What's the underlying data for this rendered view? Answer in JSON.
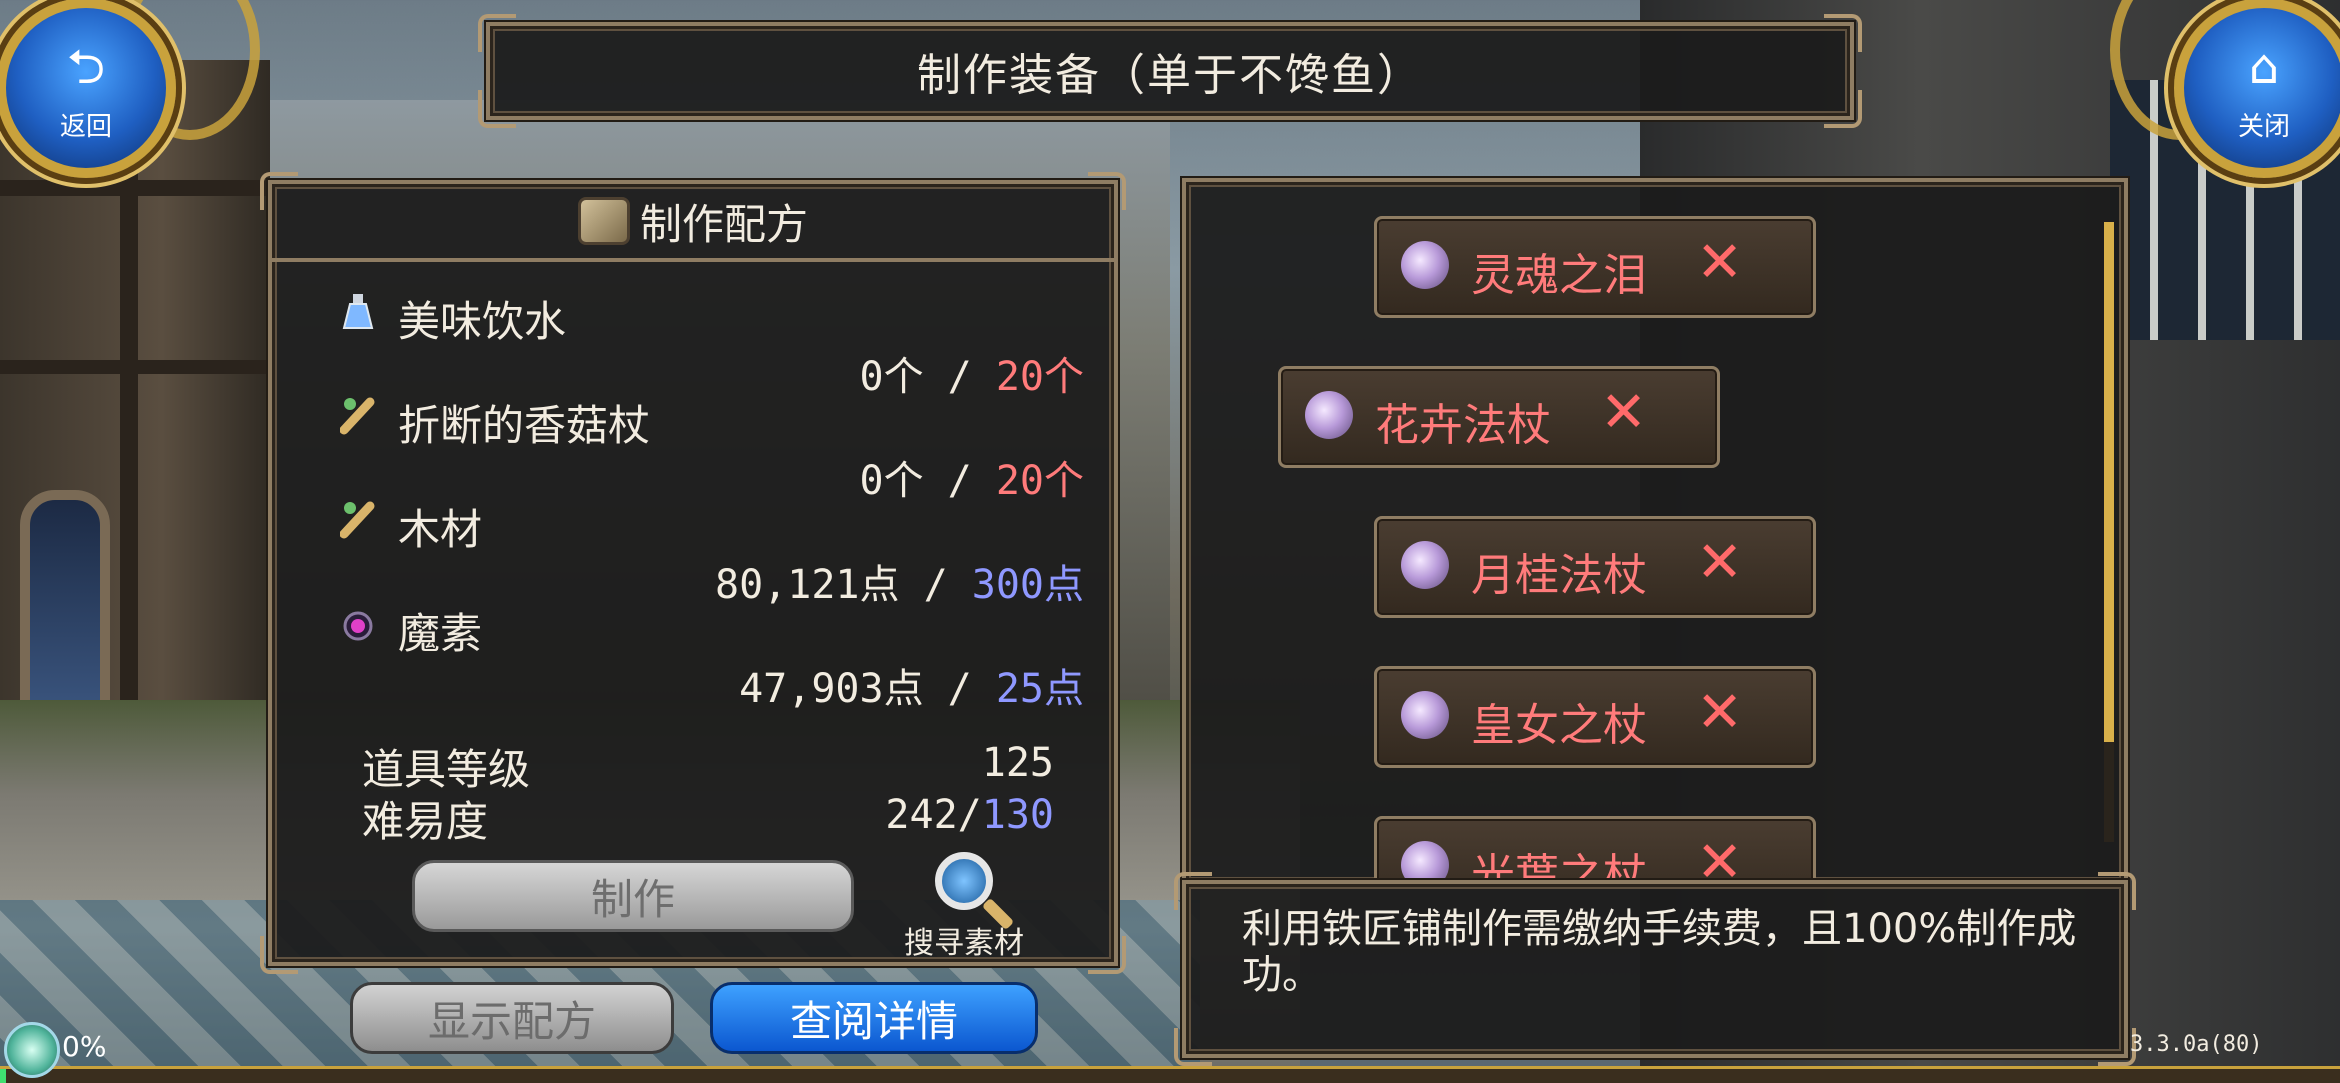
{
  "title": "制作装备（单于不馋鱼）",
  "nav": {
    "back_label": "返回",
    "close_label": "关闭",
    "back_icon": "return-arrow-icon",
    "close_icon": "home-icon"
  },
  "recipe": {
    "header": "制作配方",
    "materials": [
      {
        "name": "美味饮水",
        "have": "0个",
        "sep": " / ",
        "need": "20个",
        "need_color": "#ff7b7b",
        "icon": "potion-icon"
      },
      {
        "name": "折断的香菇杖",
        "have": "0个",
        "sep": " / ",
        "need": "20个",
        "need_color": "#ff7b7b",
        "icon": "wood-scroll-icon"
      },
      {
        "name": "木材",
        "have": "80,121点",
        "sep": " / ",
        "need": "300点",
        "need_color": "#8f98ff",
        "icon": "wood-scroll-icon"
      },
      {
        "name": "魔素",
        "have": "47,903点",
        "sep": " / ",
        "need": "25点",
        "need_color": "#8f98ff",
        "icon": "mana-orb-icon"
      }
    ],
    "item_level_label": "道具等级",
    "item_level_value": "125",
    "difficulty_label": "难易度",
    "difficulty_current": "242",
    "difficulty_sep": "/",
    "difficulty_max": "130",
    "craft_label": "制作",
    "search_label": "搜寻素材"
  },
  "buttons": {
    "show_recipe": "显示配方",
    "view_details": "查阅详情"
  },
  "list": {
    "items": [
      {
        "name": "灵魂之泪",
        "remove": "✕"
      },
      {
        "name": "花卉法杖",
        "remove": "✕"
      },
      {
        "name": "月桂法杖",
        "remove": "✕"
      },
      {
        "name": "皇女之杖",
        "remove": "✕"
      },
      {
        "name": "光葉之杖",
        "remove": "✕"
      }
    ]
  },
  "info": {
    "text": "利用铁匠铺制作需缴纳手续费，且100%制作成功。"
  },
  "hud": {
    "progress": "0%",
    "progress_value": 0,
    "version": "3.3.0a(80)"
  }
}
